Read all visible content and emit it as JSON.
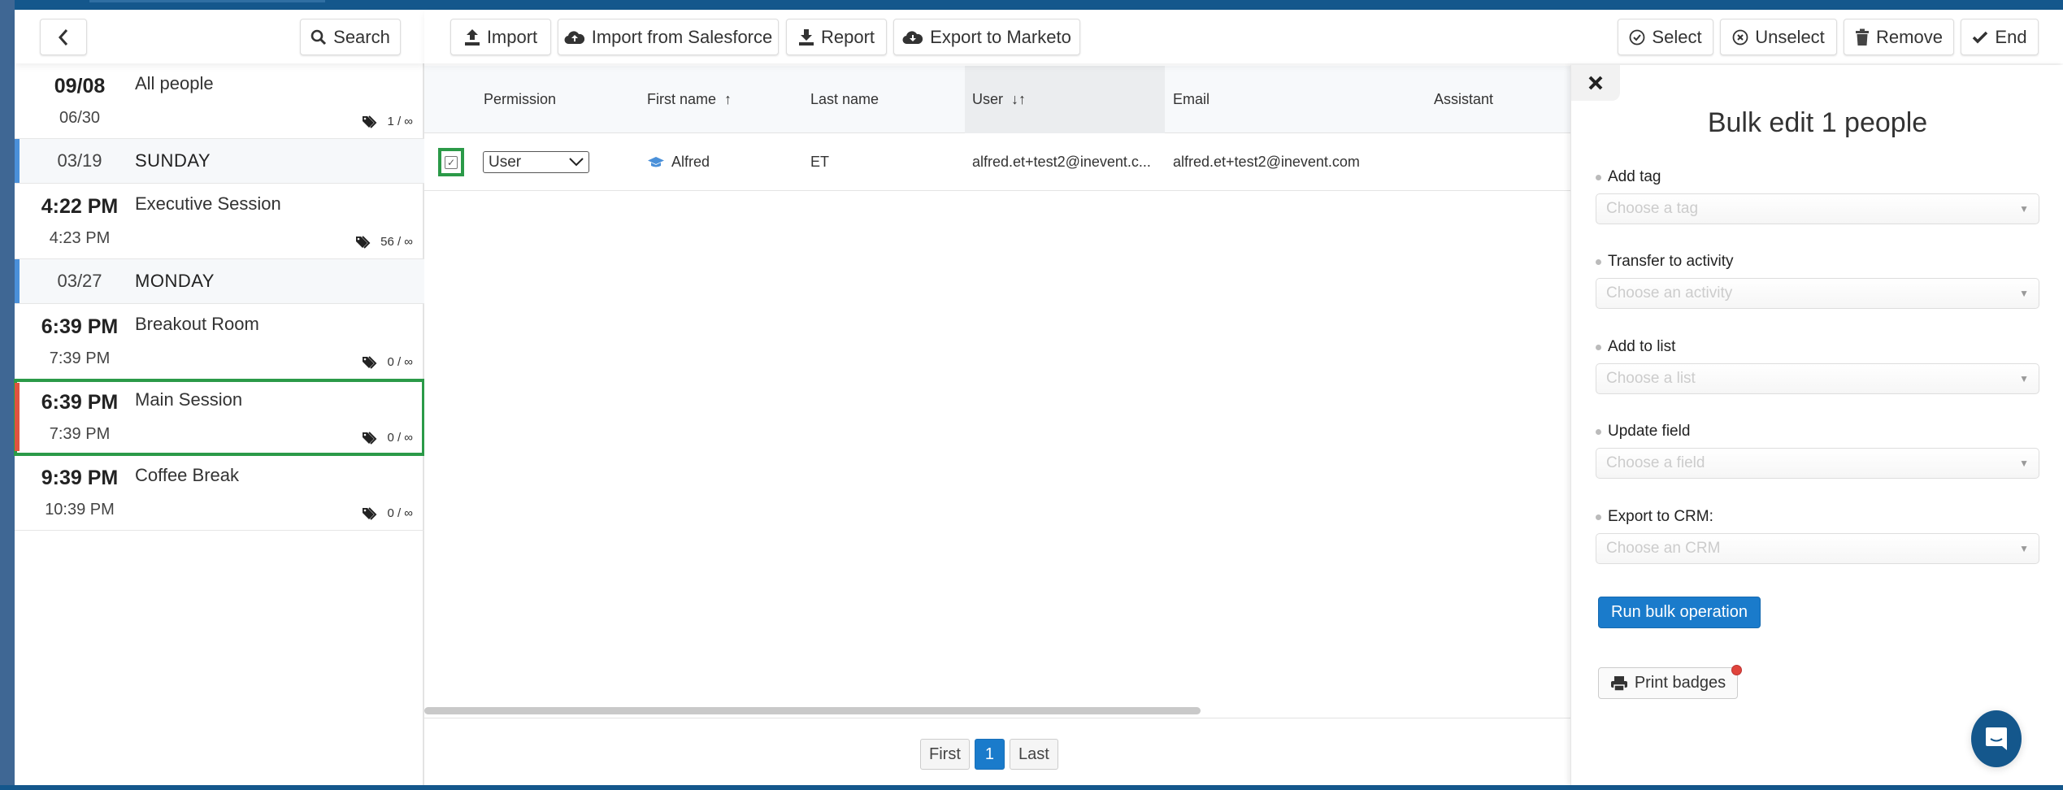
{
  "sidebar": {
    "search_label": "Search",
    "items": [
      {
        "type": "session",
        "start": "09/08",
        "end": "06/30",
        "title": "All people",
        "count": "1 / ∞",
        "dayrow": false
      },
      {
        "type": "day",
        "date": "03/19",
        "label": "SUNDAY"
      },
      {
        "type": "session",
        "start": "4:22 PM",
        "end": "4:23 PM",
        "title": "Executive Session",
        "count": "56 / ∞"
      },
      {
        "type": "day",
        "date": "03/27",
        "label": "MONDAY"
      },
      {
        "type": "session",
        "start": "6:39 PM",
        "end": "7:39 PM",
        "title": "Breakout Room",
        "count": "0 / ∞"
      },
      {
        "type": "session",
        "start": "6:39 PM",
        "end": "7:39 PM",
        "title": "Main Session",
        "count": "0 / ∞",
        "selected": true
      },
      {
        "type": "session",
        "start": "9:39 PM",
        "end": "10:39 PM",
        "title": "Coffee Break",
        "count": "0 / ∞"
      }
    ]
  },
  "toolbar": {
    "import": "Import",
    "import_salesforce": "Import from Salesforce",
    "report": "Report",
    "export_marketo": "Export to Marketo",
    "select": "Select",
    "unselect": "Unselect",
    "remove": "Remove",
    "end": "End"
  },
  "table": {
    "columns": {
      "permission": "Permission",
      "first_name": "First name",
      "first_name_sort": "↑",
      "last_name": "Last name",
      "user": "User",
      "user_sort": "↓↑",
      "email": "Email",
      "assistant": "Assistant"
    },
    "rows": [
      {
        "checked": true,
        "permission": "User",
        "first_name": "Alfred",
        "last_name": "ET",
        "user": "alfred.et+test2@inevent.c...",
        "email": "alfred.et+test2@inevent.com",
        "assistant": ""
      }
    ]
  },
  "pagination": {
    "first": "First",
    "current": "1",
    "last": "Last"
  },
  "bulk_panel": {
    "title": "Bulk edit 1 people",
    "fields": [
      {
        "label": "Add tag",
        "placeholder": "Choose a tag"
      },
      {
        "label": "Transfer to activity",
        "placeholder": "Choose an activity"
      },
      {
        "label": "Add to list",
        "placeholder": "Choose a list"
      },
      {
        "label": "Update field",
        "placeholder": "Choose a field"
      },
      {
        "label": "Export to CRM:",
        "placeholder": "Choose an CRM"
      }
    ],
    "run_label": "Run bulk operation",
    "print_label": "Print badges"
  },
  "colors": {
    "brand": "#14578c",
    "primary_button": "#1a7bcb",
    "selected_outline": "#2b9a48",
    "selected_bar": "#e0533f",
    "day_bar": "#4a90d9"
  }
}
